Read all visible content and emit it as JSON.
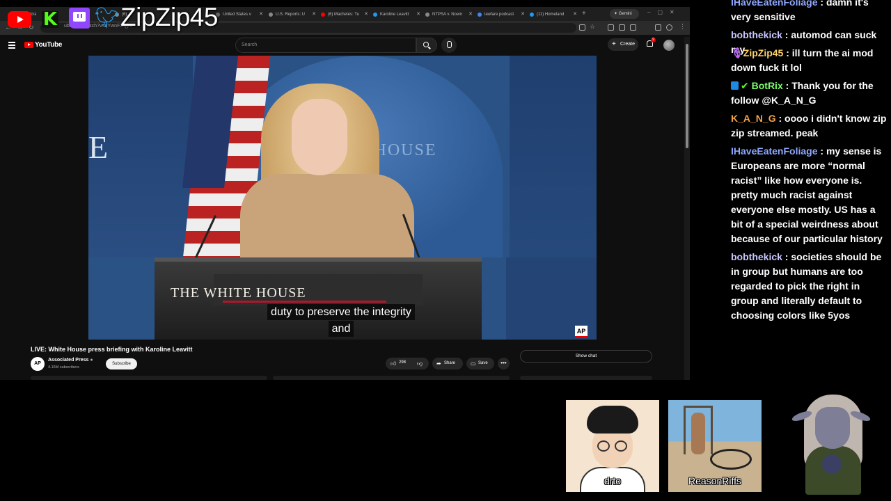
{
  "overlay": {
    "streamer_name": "ZipZip45",
    "platform_icons": [
      "youtube-icon",
      "kick-icon",
      "twitch-icon",
      "twitter-icon"
    ]
  },
  "browser": {
    "tabs": [
      {
        "label": "Ucrane",
        "color": "#ff0000"
      },
      {
        "label": "(6) U",
        "color": "#888888"
      },
      {
        "label": "United States v",
        "color": "#666666"
      },
      {
        "label": "U.S. Reports: U",
        "color": "#888888"
      },
      {
        "label": "(6) Machetes: Tu",
        "color": "#ff0000"
      },
      {
        "label": "Karoline Leavitt",
        "color": "#1d9bf0"
      },
      {
        "label": "NTPSA v. Noem",
        "color": "#888888"
      },
      {
        "label": "lawfare podcast",
        "color": "#4285f4"
      },
      {
        "label": "(11) Homeland",
        "color": "#1d9bf0"
      }
    ],
    "gemini_label": "Gemini",
    "url": "ube.com/watch?v=qYwnFSQjro"
  },
  "youtube": {
    "logo_text": "YouTube",
    "search_placeholder": "Search",
    "create_label": "Create",
    "notification_count": "9"
  },
  "video": {
    "caption_lines": [
      "duty to preserve the integrity",
      "and"
    ],
    "backdrop_text": "THE WHITE HOUSE",
    "podium_text": "THE WHITE HOUSE",
    "backdrop_partial": "E",
    "ap_bug": "AP",
    "title": "LIVE: White House press briefing with Karoline Leavitt",
    "channel_name": "Associated Press",
    "channel_avatar": "AP",
    "subscribers": "4.16M subscribers",
    "subscribe_label": "Subscribe",
    "likes": "298",
    "share_label": "Share",
    "save_label": "Save",
    "show_chat_label": "Show chat"
  },
  "chat": {
    "messages": [
      {
        "user": "IHaveEatenFoliage",
        "color": "#8fa8ff",
        "text": "damn it's very sensitive",
        "badge": ""
      },
      {
        "user": "bobthekick",
        "color": "#c8c8ff",
        "text": "automod can suck my",
        "badge": ""
      },
      {
        "user": "ZipZip45",
        "color": "#ffd36b",
        "text": "ill turn the ai mod down fuck it lol",
        "badge": "mic"
      },
      {
        "user": "BotRix",
        "color": "#7cff6b",
        "text": "Thank you for the follow @K_A_N_G",
        "badge": "bot"
      },
      {
        "user": "K_A_N_G",
        "color": "#f2a24a",
        "text": "oooo i didn't know zip zip streamed. peak",
        "badge": ""
      },
      {
        "user": "IHaveEatenFoliage",
        "color": "#8fa8ff",
        "text": "my sense is Europeans are more “normal racist” like how everyone is. pretty much racist against everyone else mostly. US has a bit of a special weirdness about because of our particular history",
        "badge": ""
      },
      {
        "user": "bobthekick",
        "color": "#c8c8ff",
        "text": "societies should be in group but humans are too regarded to pick the right in group and literally default to choosing colors like 5yos",
        "badge": ""
      }
    ]
  },
  "webcams": [
    {
      "label": "drto"
    },
    {
      "label": "ReasonRiffs"
    }
  ],
  "colors": {
    "youtube_red": "#ff0000",
    "kick_green": "#53fc18",
    "twitch_purple": "#9146ff",
    "twitter_blue": "#1d9bf0"
  }
}
